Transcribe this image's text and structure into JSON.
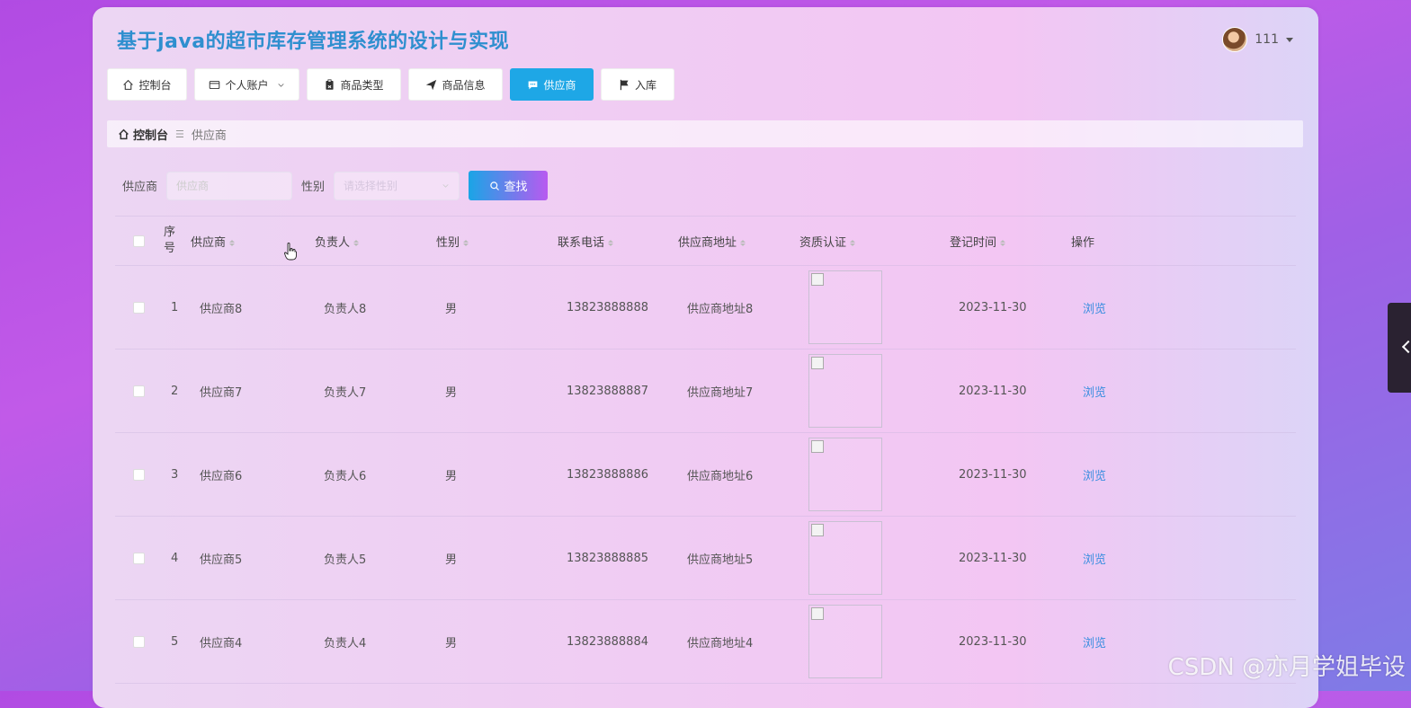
{
  "app": {
    "title": "基于java的超市库存管理系统的设计与实现"
  },
  "user": {
    "name": "111"
  },
  "nav": [
    {
      "label": "控制台",
      "icon": "home-icon",
      "active": false
    },
    {
      "label": "个人账户",
      "icon": "wallet-icon",
      "active": false,
      "dropdown": true
    },
    {
      "label": "商品类型",
      "icon": "clipboard-icon",
      "active": false
    },
    {
      "label": "商品信息",
      "icon": "send-icon",
      "active": false
    },
    {
      "label": "供应商",
      "icon": "chat-icon",
      "active": true
    },
    {
      "label": "入库",
      "icon": "flag-icon",
      "active": false
    }
  ],
  "breadcrumb": {
    "home": "控制台",
    "current": "供应商"
  },
  "search": {
    "supplier_label": "供应商",
    "supplier_placeholder": "供应商",
    "gender_label": "性别",
    "gender_placeholder": "请选择性别",
    "find_button": "查找"
  },
  "table": {
    "headers": {
      "no": "序号",
      "supplier": "供应商",
      "manager": "负责人",
      "gender": "性别",
      "phone": "联系电话",
      "address": "供应商地址",
      "cert": "资质认证",
      "time": "登记时间",
      "op": "操作"
    },
    "rows": [
      {
        "no": "1",
        "supplier": "供应商8",
        "manager": "负责人8",
        "gender": "男",
        "phone": "13823888888",
        "address": "供应商地址8",
        "time": "2023-11-30",
        "op": "浏览"
      },
      {
        "no": "2",
        "supplier": "供应商7",
        "manager": "负责人7",
        "gender": "男",
        "phone": "13823888887",
        "address": "供应商地址7",
        "time": "2023-11-30",
        "op": "浏览"
      },
      {
        "no": "3",
        "supplier": "供应商6",
        "manager": "负责人6",
        "gender": "男",
        "phone": "13823888886",
        "address": "供应商地址6",
        "time": "2023-11-30",
        "op": "浏览"
      },
      {
        "no": "4",
        "supplier": "供应商5",
        "manager": "负责人5",
        "gender": "男",
        "phone": "13823888885",
        "address": "供应商地址5",
        "time": "2023-11-30",
        "op": "浏览"
      },
      {
        "no": "5",
        "supplier": "供应商4",
        "manager": "负责人4",
        "gender": "男",
        "phone": "13823888884",
        "address": "供应商地址4",
        "time": "2023-11-30",
        "op": "浏览"
      }
    ]
  },
  "watermark": "CSDN @亦月学姐毕设"
}
